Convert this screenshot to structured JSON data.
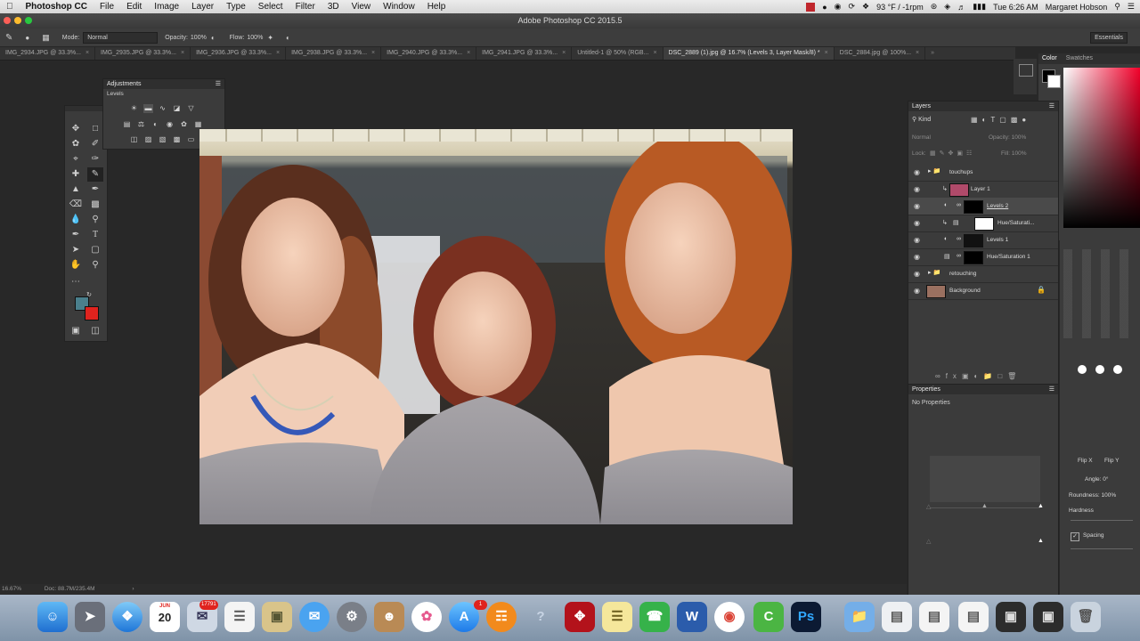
{
  "menubar": {
    "app_name": "Photoshop CC",
    "items": [
      "File",
      "Edit",
      "Image",
      "Layer",
      "Type",
      "Select",
      "Filter",
      "3D",
      "View",
      "Window",
      "Help"
    ],
    "weather": "93 °F / -1rpm",
    "clock": "Tue 6:26 AM",
    "user": "Margaret Hobson"
  },
  "window": {
    "title": "Adobe Photoshop CC 2015.5"
  },
  "options": {
    "mode_label": "Mode:",
    "mode_value": "Normal",
    "opacity_label": "Opacity:",
    "opacity_value": "100%",
    "flow_label": "Flow:",
    "flow_value": "100%",
    "workspace": "Essentials"
  },
  "tabs": [
    {
      "label": "IMG_2934.JPG @ 33.3%...",
      "active": false
    },
    {
      "label": "IMG_2935.JPG @ 33.3%...",
      "active": false
    },
    {
      "label": "IMG_2936.JPG @ 33.3%...",
      "active": false
    },
    {
      "label": "IMG_2938.JPG @ 33.3%...",
      "active": false
    },
    {
      "label": "IMG_2940.JPG @ 33.3%...",
      "active": false
    },
    {
      "label": "IMG_2941.JPG @ 33.3%...",
      "active": false
    },
    {
      "label": "Untitled-1 @ 50% (RGB...",
      "active": false
    },
    {
      "label": "DSC_2889 (1).jpg @ 16.7% (Levels 3, Layer Mask/8) *",
      "active": true
    },
    {
      "label": "DSC_2884.jpg @ 100%...",
      "active": false
    }
  ],
  "adjustments": {
    "title": "Adjustments",
    "subtitle": "Levels"
  },
  "toolbox": {
    "foreground_color": "#4a7f8c",
    "background_color": "#e0231e"
  },
  "color_panel": {
    "tab_color": "Color",
    "tab_swatches": "Swatches"
  },
  "layers": {
    "title": "Layers",
    "filter_kind": "Kind",
    "blend_mode": "Normal",
    "opacity_label": "Opacity:",
    "opacity_value": "100%",
    "lock_label": "Lock:",
    "fill_label": "Fill:",
    "fill_value": "100%",
    "rows": [
      {
        "name": "touchups",
        "kind": "group",
        "indent": 0,
        "thumb": ""
      },
      {
        "name": "Layer 1",
        "kind": "layer",
        "indent": 2,
        "thumb": "#b04a6a"
      },
      {
        "name": "Levels 2",
        "kind": "adjust",
        "indent": 2,
        "thumb": "#000000"
      },
      {
        "name": "Hue/Saturati...",
        "kind": "adjust",
        "indent": 2,
        "thumb": "#ffffff"
      },
      {
        "name": "Levels 1",
        "kind": "adjust",
        "indent": 2,
        "thumb": "#111111"
      },
      {
        "name": "Hue/Saturation 1",
        "kind": "adjust",
        "indent": 2,
        "thumb": "#000000"
      },
      {
        "name": "retouching",
        "kind": "group",
        "indent": 0,
        "thumb": ""
      },
      {
        "name": "Background",
        "kind": "background",
        "indent": 0,
        "thumb": "#9a7060"
      }
    ]
  },
  "properties": {
    "title": "Properties",
    "message": "No Properties"
  },
  "brush": {
    "flip_x": "Flip X",
    "flip_y": "Flip Y",
    "angle_label": "Angle:",
    "angle_value": "0°",
    "roundness_label": "Roundness:",
    "roundness_value": "100%",
    "hardness_label": "Hardness",
    "spacing_label": "Spacing"
  },
  "status": {
    "zoom": "16.67%",
    "doc": "Doc: 88.7M/235.4M"
  },
  "dock": {
    "calendar_month": "JUN",
    "calendar_day": "20",
    "mail_badge": "17791",
    "appstore_badge": "1"
  }
}
